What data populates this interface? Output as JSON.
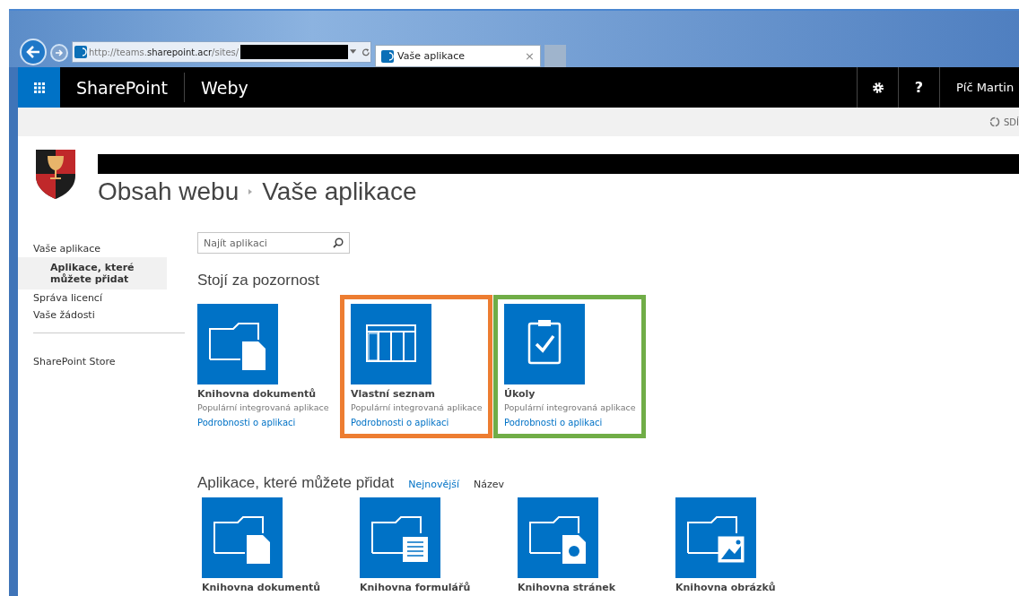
{
  "browser": {
    "address": {
      "prefix": "http://teams.",
      "host": "sharepoint.acr",
      "path": "/sites/"
    },
    "tabs": [
      {
        "title": "Vaše aplikace",
        "close": "×",
        "selected": true
      }
    ]
  },
  "suite_bar": {
    "brand": "SharePoint",
    "section": "Weby",
    "help": "?",
    "user": "Píč Martin"
  },
  "ribbon": {
    "share": "SDÍ"
  },
  "page": {
    "breadcrumb": [
      "Obsah webu",
      "Vaše aplikace"
    ]
  },
  "sidebar": {
    "items": [
      {
        "label": "Vaše aplikace",
        "selected": false,
        "children": [
          {
            "label": "Aplikace, které můžete přidat",
            "selected": true
          }
        ]
      },
      {
        "label": "Správa licencí",
        "selected": false
      },
      {
        "label": "Vaše žádosti",
        "selected": false
      },
      {
        "label": "SharePoint Store",
        "selected": false,
        "separated": true
      }
    ]
  },
  "search": {
    "placeholder": "Najít aplikaci"
  },
  "featured": {
    "heading": "Stojí za pozornost",
    "apps": [
      {
        "kind": "document",
        "title": "Knihovna dokumentů",
        "subtitle": "Populární integrovaná aplikace",
        "link": "Podrobnosti o aplikaci"
      },
      {
        "kind": "list",
        "title": "Vlastní seznam",
        "subtitle": "Populární integrovaná aplikace",
        "link": "Podrobnosti o aplikaci",
        "color": "#ed7d31"
      },
      {
        "kind": "tasks",
        "title": "Úkoly",
        "subtitle": "Populární integrovaná aplikace",
        "link": "Podrobnosti o aplikaci",
        "color": "#70ad47"
      }
    ]
  },
  "available": {
    "heading": "Aplikace, které můžete přidat",
    "sort": [
      {
        "label": "Nejnovější",
        "selected": false
      },
      {
        "label": "Název",
        "selected": true
      }
    ],
    "apps": [
      {
        "kind": "document",
        "title": "Knihovna dokumentů"
      },
      {
        "kind": "form",
        "title": "Knihovna formulářů"
      },
      {
        "kind": "page",
        "title": "Knihovna stránek"
      },
      {
        "kind": "picture",
        "title": "Knihovna obrázků"
      }
    ]
  }
}
